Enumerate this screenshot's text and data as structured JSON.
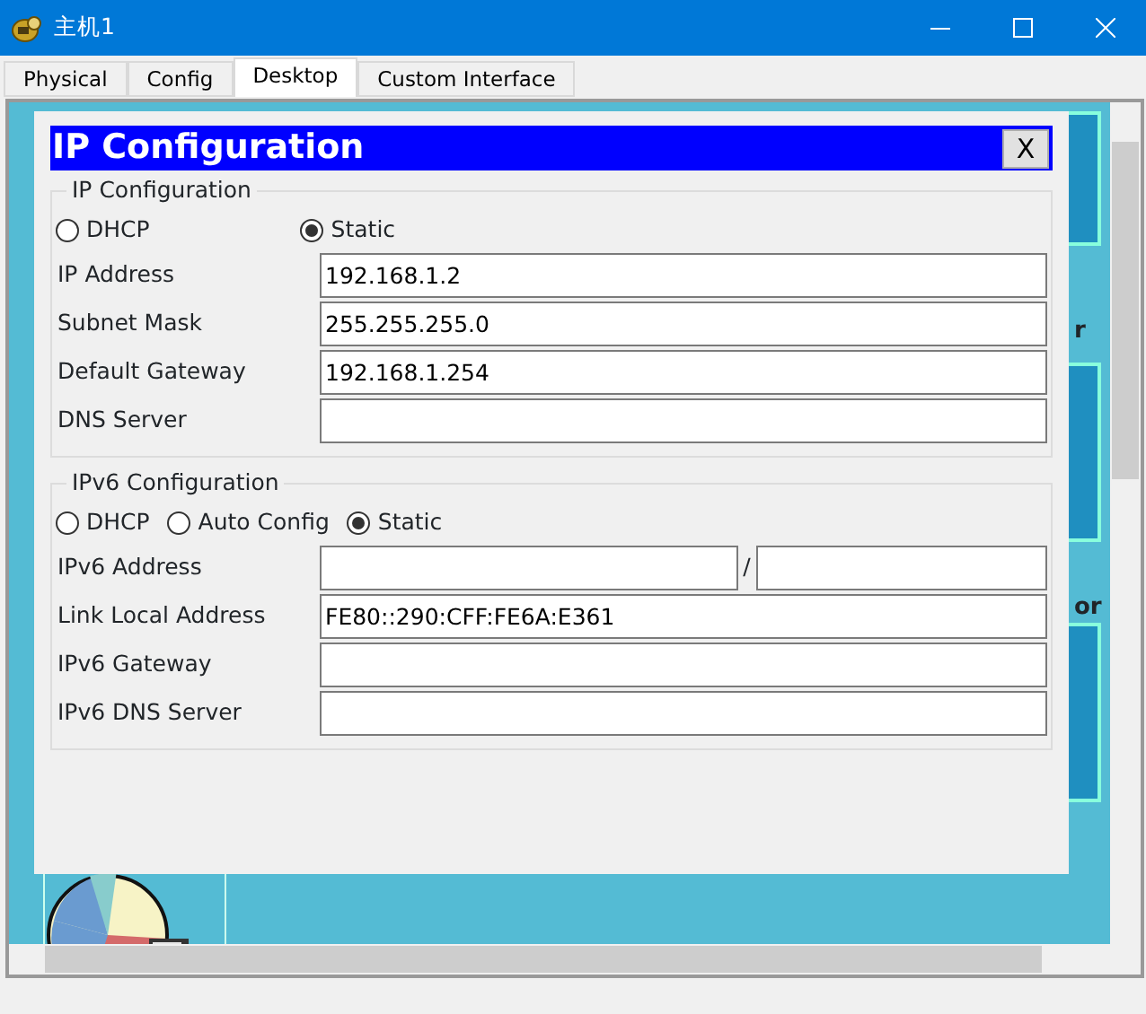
{
  "window": {
    "title": "主机1"
  },
  "tabs": [
    {
      "label": "Physical",
      "selected": false
    },
    {
      "label": "Config",
      "selected": false
    },
    {
      "label": "Desktop",
      "selected": true
    },
    {
      "label": "Custom Interface",
      "selected": false
    }
  ],
  "background_labels": [
    "r",
    "or"
  ],
  "dialog": {
    "title": "IP Configuration",
    "close": "X",
    "ipv4": {
      "legend": "IP Configuration",
      "modes": [
        {
          "label": "DHCP",
          "selected": false
        },
        {
          "label": "Static",
          "selected": true
        }
      ],
      "fields": [
        {
          "label": "IP Address",
          "value": "192.168.1.2"
        },
        {
          "label": "Subnet Mask",
          "value": "255.255.255.0"
        },
        {
          "label": "Default Gateway",
          "value": "192.168.1.254"
        },
        {
          "label": "DNS Server"
        }
      ]
    },
    "ipv6": {
      "legend": "IPv6 Configuration",
      "modes": [
        {
          "label": "DHCP",
          "selected": false
        },
        {
          "label": "Auto Config",
          "selected": false
        },
        {
          "label": "Static",
          "selected": true
        }
      ],
      "fields": [
        {
          "label": "IPv6 Address",
          "kind": "prefix",
          "separator": "/"
        },
        {
          "label": "Link Local Address",
          "kind": "plain",
          "value": "FE80::290:CFF:FE6A:E361"
        },
        {
          "label": "IPv6 Gateway",
          "kind": "plain"
        },
        {
          "label": "IPv6 DNS Server",
          "kind": "plain"
        }
      ]
    }
  }
}
